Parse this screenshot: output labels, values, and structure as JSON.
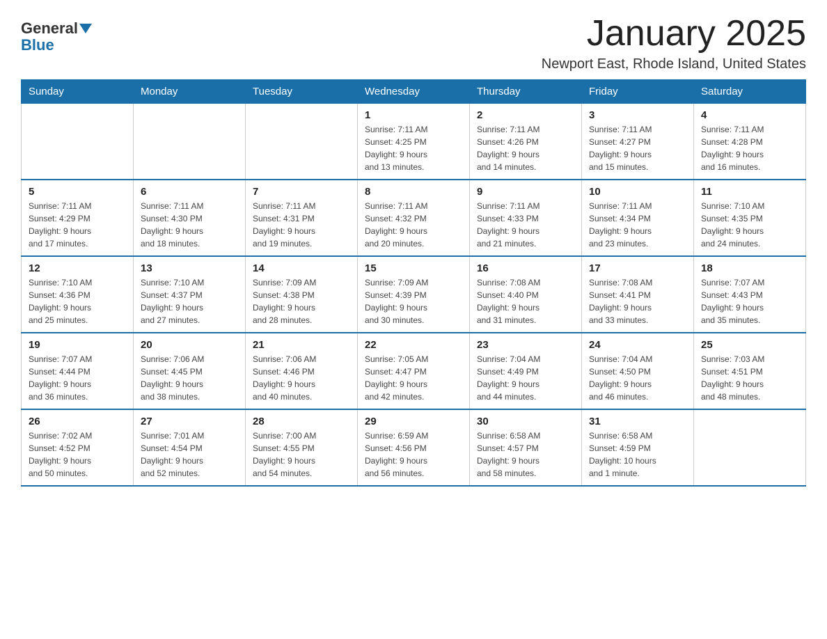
{
  "header": {
    "logo_text_general": "General",
    "logo_text_blue": "Blue",
    "title": "January 2025",
    "subtitle": "Newport East, Rhode Island, United States"
  },
  "days_of_week": [
    "Sunday",
    "Monday",
    "Tuesday",
    "Wednesday",
    "Thursday",
    "Friday",
    "Saturday"
  ],
  "weeks": [
    [
      {
        "day": "",
        "info": ""
      },
      {
        "day": "",
        "info": ""
      },
      {
        "day": "",
        "info": ""
      },
      {
        "day": "1",
        "info": "Sunrise: 7:11 AM\nSunset: 4:25 PM\nDaylight: 9 hours\nand 13 minutes."
      },
      {
        "day": "2",
        "info": "Sunrise: 7:11 AM\nSunset: 4:26 PM\nDaylight: 9 hours\nand 14 minutes."
      },
      {
        "day": "3",
        "info": "Sunrise: 7:11 AM\nSunset: 4:27 PM\nDaylight: 9 hours\nand 15 minutes."
      },
      {
        "day": "4",
        "info": "Sunrise: 7:11 AM\nSunset: 4:28 PM\nDaylight: 9 hours\nand 16 minutes."
      }
    ],
    [
      {
        "day": "5",
        "info": "Sunrise: 7:11 AM\nSunset: 4:29 PM\nDaylight: 9 hours\nand 17 minutes."
      },
      {
        "day": "6",
        "info": "Sunrise: 7:11 AM\nSunset: 4:30 PM\nDaylight: 9 hours\nand 18 minutes."
      },
      {
        "day": "7",
        "info": "Sunrise: 7:11 AM\nSunset: 4:31 PM\nDaylight: 9 hours\nand 19 minutes."
      },
      {
        "day": "8",
        "info": "Sunrise: 7:11 AM\nSunset: 4:32 PM\nDaylight: 9 hours\nand 20 minutes."
      },
      {
        "day": "9",
        "info": "Sunrise: 7:11 AM\nSunset: 4:33 PM\nDaylight: 9 hours\nand 21 minutes."
      },
      {
        "day": "10",
        "info": "Sunrise: 7:11 AM\nSunset: 4:34 PM\nDaylight: 9 hours\nand 23 minutes."
      },
      {
        "day": "11",
        "info": "Sunrise: 7:10 AM\nSunset: 4:35 PM\nDaylight: 9 hours\nand 24 minutes."
      }
    ],
    [
      {
        "day": "12",
        "info": "Sunrise: 7:10 AM\nSunset: 4:36 PM\nDaylight: 9 hours\nand 25 minutes."
      },
      {
        "day": "13",
        "info": "Sunrise: 7:10 AM\nSunset: 4:37 PM\nDaylight: 9 hours\nand 27 minutes."
      },
      {
        "day": "14",
        "info": "Sunrise: 7:09 AM\nSunset: 4:38 PM\nDaylight: 9 hours\nand 28 minutes."
      },
      {
        "day": "15",
        "info": "Sunrise: 7:09 AM\nSunset: 4:39 PM\nDaylight: 9 hours\nand 30 minutes."
      },
      {
        "day": "16",
        "info": "Sunrise: 7:08 AM\nSunset: 4:40 PM\nDaylight: 9 hours\nand 31 minutes."
      },
      {
        "day": "17",
        "info": "Sunrise: 7:08 AM\nSunset: 4:41 PM\nDaylight: 9 hours\nand 33 minutes."
      },
      {
        "day": "18",
        "info": "Sunrise: 7:07 AM\nSunset: 4:43 PM\nDaylight: 9 hours\nand 35 minutes."
      }
    ],
    [
      {
        "day": "19",
        "info": "Sunrise: 7:07 AM\nSunset: 4:44 PM\nDaylight: 9 hours\nand 36 minutes."
      },
      {
        "day": "20",
        "info": "Sunrise: 7:06 AM\nSunset: 4:45 PM\nDaylight: 9 hours\nand 38 minutes."
      },
      {
        "day": "21",
        "info": "Sunrise: 7:06 AM\nSunset: 4:46 PM\nDaylight: 9 hours\nand 40 minutes."
      },
      {
        "day": "22",
        "info": "Sunrise: 7:05 AM\nSunset: 4:47 PM\nDaylight: 9 hours\nand 42 minutes."
      },
      {
        "day": "23",
        "info": "Sunrise: 7:04 AM\nSunset: 4:49 PM\nDaylight: 9 hours\nand 44 minutes."
      },
      {
        "day": "24",
        "info": "Sunrise: 7:04 AM\nSunset: 4:50 PM\nDaylight: 9 hours\nand 46 minutes."
      },
      {
        "day": "25",
        "info": "Sunrise: 7:03 AM\nSunset: 4:51 PM\nDaylight: 9 hours\nand 48 minutes."
      }
    ],
    [
      {
        "day": "26",
        "info": "Sunrise: 7:02 AM\nSunset: 4:52 PM\nDaylight: 9 hours\nand 50 minutes."
      },
      {
        "day": "27",
        "info": "Sunrise: 7:01 AM\nSunset: 4:54 PM\nDaylight: 9 hours\nand 52 minutes."
      },
      {
        "day": "28",
        "info": "Sunrise: 7:00 AM\nSunset: 4:55 PM\nDaylight: 9 hours\nand 54 minutes."
      },
      {
        "day": "29",
        "info": "Sunrise: 6:59 AM\nSunset: 4:56 PM\nDaylight: 9 hours\nand 56 minutes."
      },
      {
        "day": "30",
        "info": "Sunrise: 6:58 AM\nSunset: 4:57 PM\nDaylight: 9 hours\nand 58 minutes."
      },
      {
        "day": "31",
        "info": "Sunrise: 6:58 AM\nSunset: 4:59 PM\nDaylight: 10 hours\nand 1 minute."
      },
      {
        "day": "",
        "info": ""
      }
    ]
  ]
}
